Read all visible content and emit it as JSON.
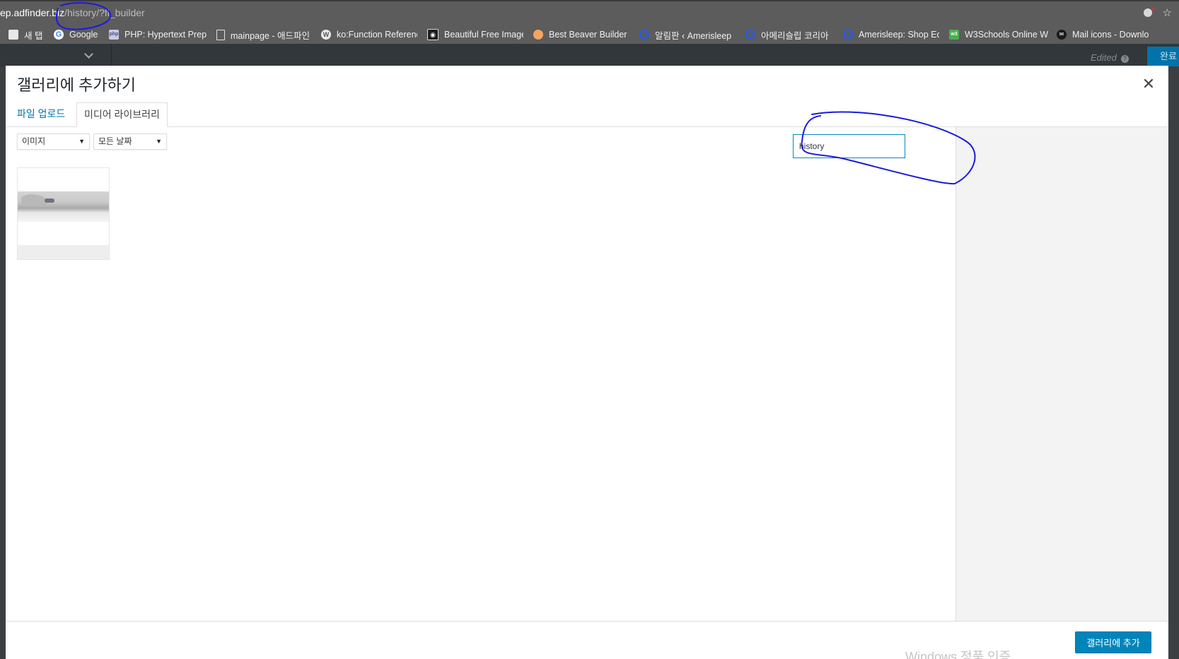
{
  "browser": {
    "url_host": "ep.adfinder.biz",
    "url_path": "/history/?fl_builder",
    "bookmarks": [
      {
        "label": "새 탭",
        "icon": "folder-icon"
      },
      {
        "label": "Google",
        "icon": "google-icon"
      },
      {
        "label": "PHP: Hypertext Prep",
        "icon": "php-icon"
      },
      {
        "label": "mainpage - 애드파인",
        "icon": "page-icon"
      },
      {
        "label": "ko:Function Referenc",
        "icon": "wordpress-icon"
      },
      {
        "label": "Beautiful Free Image",
        "icon": "camera-icon"
      },
      {
        "label": "Best Beaver Builder",
        "icon": "beaver-icon"
      },
      {
        "label": "알림판 ‹ Amerisleep",
        "icon": "amerisleep-icon"
      },
      {
        "label": "아메리슬립 코리아",
        "icon": "amerisleep-icon"
      },
      {
        "label": "Amerisleep: Shop Ec",
        "icon": "amerisleep-icon"
      },
      {
        "label": "W3Schools Online W",
        "icon": "w3schools-icon"
      },
      {
        "label": "Mail icons - Downlo",
        "icon": "mail-icon"
      }
    ]
  },
  "builder": {
    "status": "Edited",
    "done_label": "완료"
  },
  "modal": {
    "title": "갤러리에 추가하기",
    "tabs": [
      {
        "label": "파일 업로드"
      },
      {
        "label": "미디어 라이브러리"
      }
    ],
    "filters": {
      "type": "이미지",
      "date": "모든 날짜"
    },
    "search": {
      "value": "history"
    },
    "submit_label": "갤러리에 추가",
    "watermark": "Windows 정품 인증"
  },
  "colors": {
    "accent": "#0085ba",
    "annotation": "#1a1adc"
  }
}
